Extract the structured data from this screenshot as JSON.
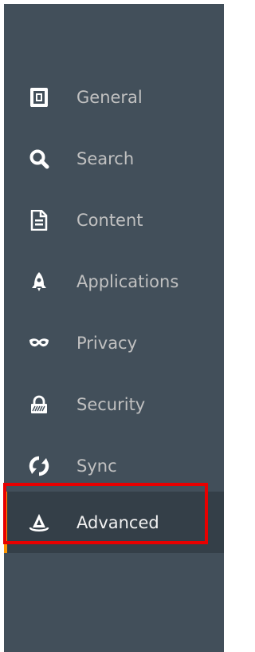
{
  "sidebar": {
    "items": [
      {
        "label": "General",
        "icon": "general-icon",
        "selected": false
      },
      {
        "label": "Search",
        "icon": "search-icon",
        "selected": false
      },
      {
        "label": "Content",
        "icon": "content-icon",
        "selected": false
      },
      {
        "label": "Applications",
        "icon": "applications-icon",
        "selected": false
      },
      {
        "label": "Privacy",
        "icon": "privacy-icon",
        "selected": false
      },
      {
        "label": "Security",
        "icon": "security-icon",
        "selected": false
      },
      {
        "label": "Sync",
        "icon": "sync-icon",
        "selected": false
      },
      {
        "label": "Advanced",
        "icon": "advanced-icon",
        "selected": true
      }
    ]
  },
  "colors": {
    "sidebar_bg": "#424f5a",
    "selected_bg": "#343f48",
    "accent": "#ff9500",
    "label": "#c1c1c1",
    "highlight": "#e80000"
  }
}
